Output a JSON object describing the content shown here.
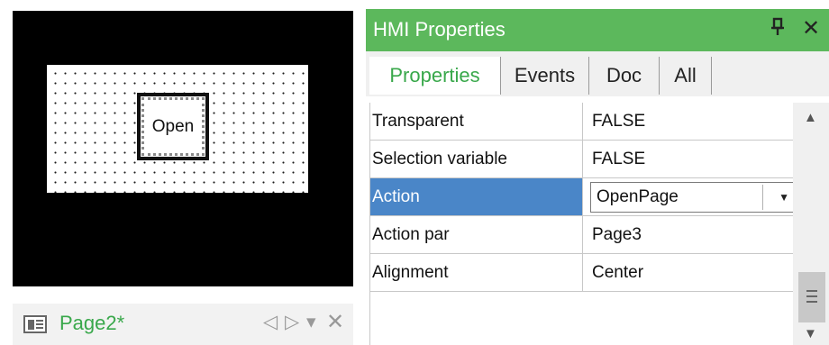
{
  "editor": {
    "button_label": "Open",
    "page_tab": {
      "label": "Page2*",
      "icon": "page-icon",
      "nav_prev": "◁",
      "nav_next": "▷",
      "nav_menu": "▾",
      "nav_close": "✕"
    }
  },
  "panel": {
    "title": "HMI Properties",
    "pin_icon": "ᵽ",
    "close_icon": "✕",
    "tabs": [
      {
        "label": "Properties",
        "active": true
      },
      {
        "label": "Events"
      },
      {
        "label": "Doc"
      },
      {
        "label": "All"
      }
    ],
    "properties": [
      {
        "key": "Transparent",
        "value": "FALSE"
      },
      {
        "key": "Selection variable",
        "value": "FALSE"
      },
      {
        "key": "Action",
        "value": "OpenPage",
        "selected": true,
        "type": "dropdown"
      },
      {
        "key": "Action par",
        "value": "Page3"
      },
      {
        "key": "Alignment",
        "value": "Center"
      }
    ],
    "scroll_up": "▲",
    "scroll_down": "▼",
    "accent_color": "#5cb85c",
    "selection_color": "#4a86c8"
  }
}
